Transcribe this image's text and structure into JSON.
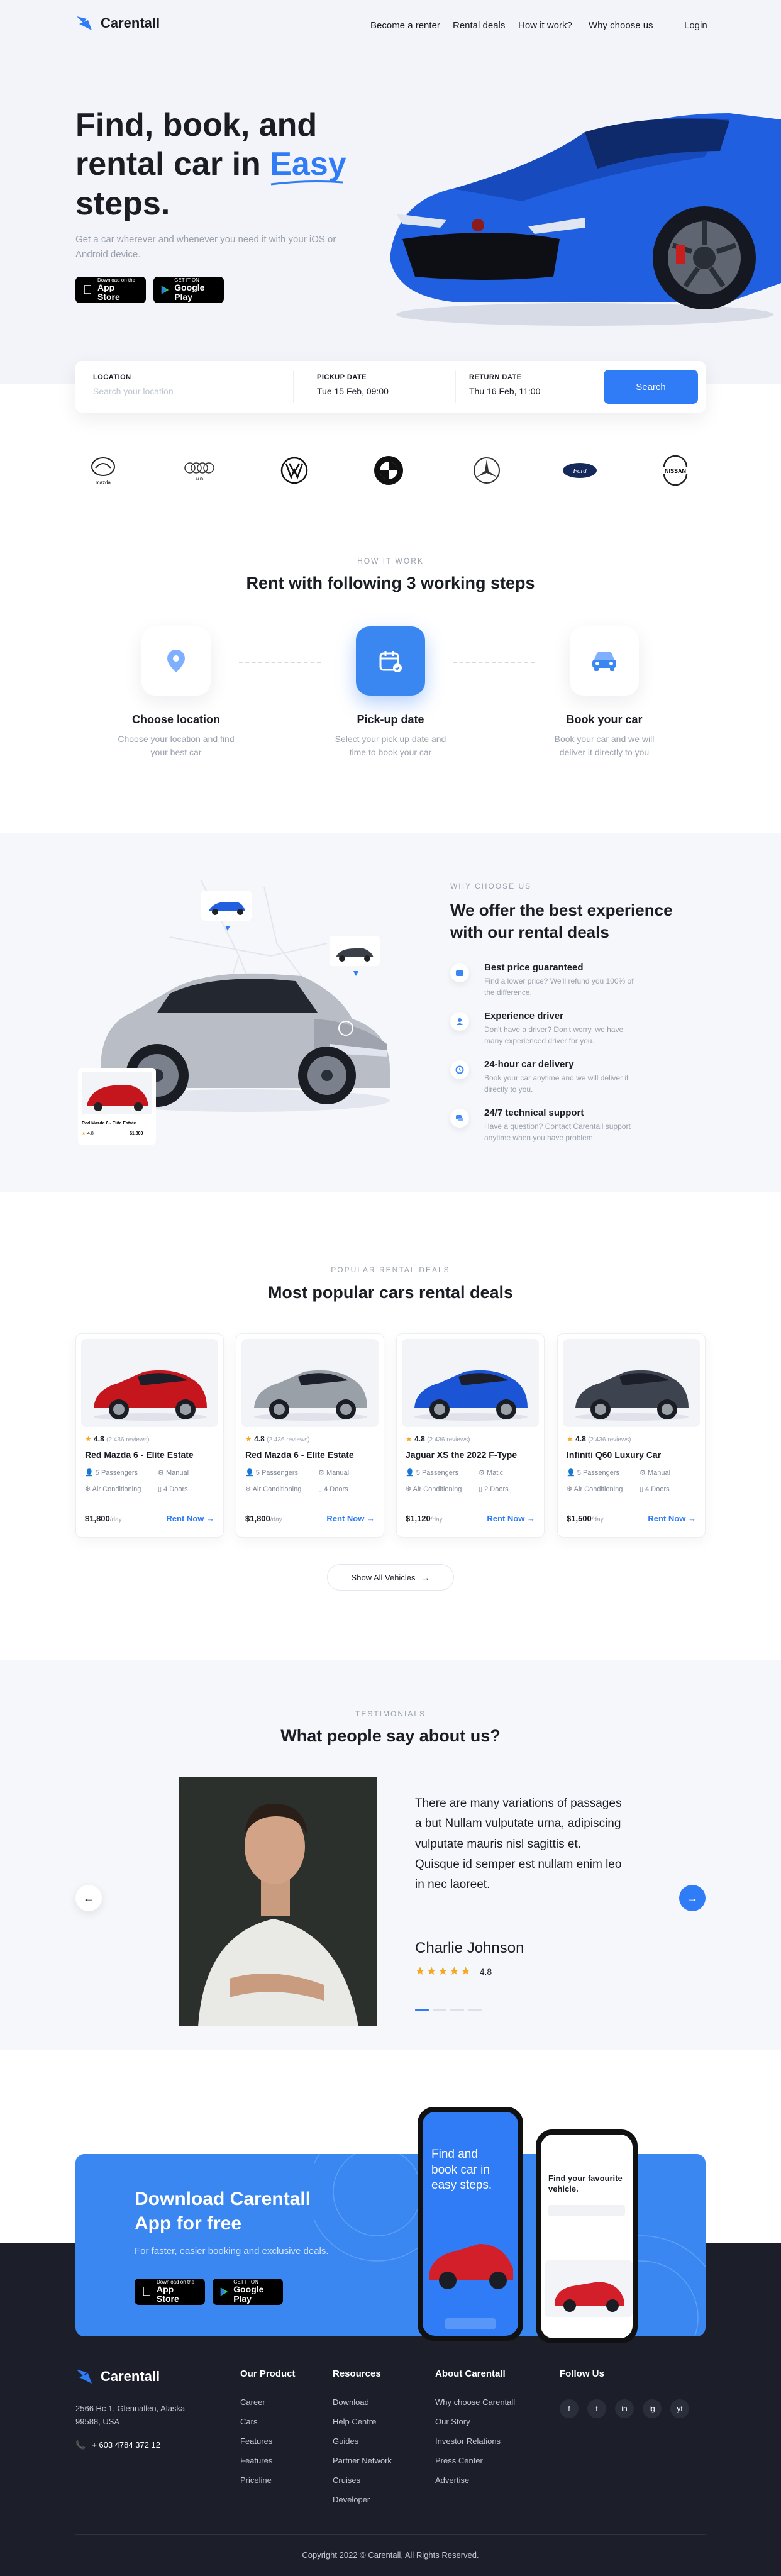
{
  "colors": {
    "accent": "#2f7cf6",
    "dark": "#1c1f2a",
    "muted": "#9aa1ad"
  },
  "header": {
    "brand": "Carentall",
    "nav": [
      "Become a renter",
      "Rental deals",
      "How it work?",
      "Why choose us"
    ],
    "login": "Login"
  },
  "hero": {
    "line1": "Find, book, and",
    "line2a": "rental car in",
    "line2b": "Easy",
    "line3": "steps.",
    "subtitle": "Get a car wherever and whenever you need it with your iOS or Android device.",
    "appstore_small": "Download on the",
    "appstore_big": "App Store",
    "gplay_small": "GET IT ON",
    "gplay_big": "Google Play"
  },
  "search": {
    "location_label": "LOCATION",
    "location_placeholder": "Search your location",
    "pickup_label": "PICKUP DATE",
    "pickup_value": "Tue 15 Feb, 09:00",
    "return_label": "RETURN DATE",
    "return_value": "Thu 16 Feb, 11:00",
    "button": "Search"
  },
  "brands": [
    "mazda",
    "AUDI",
    "VW",
    "BMW",
    "Mercedes",
    "Ford",
    "NISSAN"
  ],
  "how": {
    "eyebrow": "HOW IT WORK",
    "title": "Rent with following 3 working steps",
    "steps": [
      {
        "title": "Choose location",
        "desc": "Choose your location and find your best car"
      },
      {
        "title": "Pick-up date",
        "desc": "Select your pick up date and time to book your car"
      },
      {
        "title": "Book your car",
        "desc": "Book your car and we will deliver it directly to you"
      }
    ]
  },
  "why": {
    "eyebrow": "WHY CHOOSE US",
    "title1": "We offer the best experience",
    "title2": "with our rental deals",
    "mini_car": "Red Mazda 6 - Elite Estate",
    "mini_rating": "4.8",
    "mini_price": "$1,800",
    "features": [
      {
        "title": "Best price guaranteed",
        "desc": "Find a lower price? We'll refund you 100% of the difference."
      },
      {
        "title": "Experience driver",
        "desc": "Don't have a driver? Don't worry, we have many experienced driver for you."
      },
      {
        "title": "24-hour car delivery",
        "desc": "Book your car anytime and we will deliver it directly to you."
      },
      {
        "title": "24/7 technical support",
        "desc": "Have a question? Contact Carentall support anytime when you have problem."
      }
    ]
  },
  "deals": {
    "eyebrow": "POPULAR RENTAL DEALS",
    "title": "Most popular cars rental deals",
    "show_all": "Show All Vehicles",
    "cars": [
      {
        "name": "Red Mazda 6 - Elite Estate",
        "rating": "4.8",
        "reviews": "(2.436 reviews)",
        "passengers": "5 Passengers",
        "trans": "Manual",
        "ac": "Air Conditioning",
        "doors": "4 Doors",
        "price": "$1,800",
        "per": "/day",
        "rent": "Rent Now",
        "color": "#c4161c"
      },
      {
        "name": "Red Mazda 6 - Elite Estate",
        "rating": "4.8",
        "reviews": "(2.436 reviews)",
        "passengers": "5 Passengers",
        "trans": "Manual",
        "ac": "Air Conditioning",
        "doors": "4 Doors",
        "price": "$1,800",
        "per": "/day",
        "rent": "Rent Now",
        "color": "#9aa0a8"
      },
      {
        "name": "Jaguar XS the 2022 F-Type",
        "rating": "4.8",
        "reviews": "(2.436 reviews)",
        "passengers": "5 Passengers",
        "trans": "Matic",
        "ac": "Air Conditioning",
        "doors": "2 Doors",
        "price": "$1,120",
        "per": "/day",
        "rent": "Rent Now",
        "color": "#1c54d6"
      },
      {
        "name": "Infiniti Q60 Luxury Car",
        "rating": "4.8",
        "reviews": "(2.436 reviews)",
        "passengers": "5 Passengers",
        "trans": "Manual",
        "ac": "Air Conditioning",
        "doors": "4 Doors",
        "price": "$1,500",
        "per": "/day",
        "rent": "Rent Now",
        "color": "#3e4350"
      }
    ]
  },
  "testimonials": {
    "eyebrow": "TESTIMONIALS",
    "title": "What people say about us?",
    "quote": "There are many variations of passages a but Nullam vulputate urna, adipiscing vulputate mauris nisl sagittis et. Quisque id semper est nullam enim leo in nec laoreet.",
    "name": "Charlie Johnson",
    "rating": "4.8"
  },
  "download": {
    "title1": "Download Carentall",
    "title2": "App for free",
    "subtitle": "For faster, easier booking and exclusive deals.",
    "phone1_text": "Find and book car in easy steps.",
    "phone2_text": "Find your favourite vehicle."
  },
  "footer": {
    "brand": "Carentall",
    "address": "2566 Hc 1, Glennallen, Alaska 99588, USA",
    "phone": "+ 603 4784 372 12",
    "product_title": "Our Product",
    "product": [
      "Career",
      "Cars",
      "Features",
      "Features",
      "Priceline"
    ],
    "resources_title": "Resources",
    "resources": [
      "Download",
      "Help Centre",
      "Guides",
      "Partner Network",
      "Cruises",
      "Developer"
    ],
    "about_title": "About Carentall",
    "about": [
      "Why choose Carentall",
      "Our Story",
      "Investor Relations",
      "Press Center",
      "Advertise"
    ],
    "follow_title": "Follow Us",
    "social": [
      "f",
      "t",
      "in",
      "ig",
      "yt"
    ],
    "copyright": "Copyright 2022 © Carentall, All Rights Reserved."
  }
}
